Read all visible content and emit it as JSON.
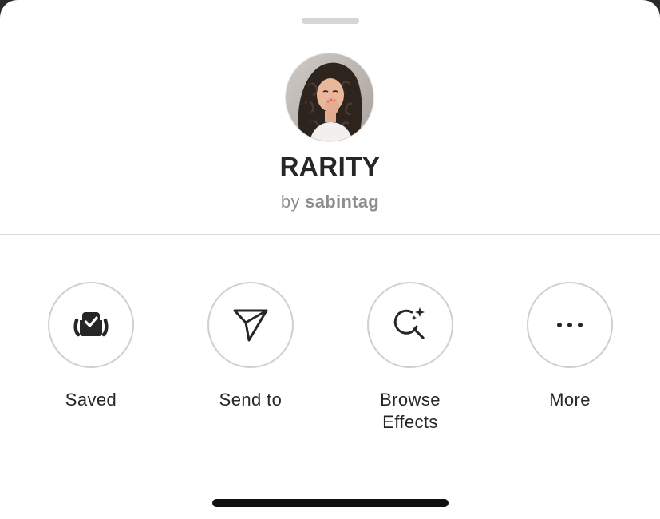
{
  "sheet": {
    "effect_name": "RARITY",
    "by_prefix": "by",
    "creator": "sabintag",
    "avatar_icon": "creator-avatar"
  },
  "actions": [
    {
      "label": "Saved",
      "icon": "saved-check-icon"
    },
    {
      "label": "Send to",
      "icon": "paper-plane-icon"
    },
    {
      "label": "Browse Effects",
      "icon": "search-sparkle-icon"
    },
    {
      "label": "More",
      "icon": "more-dots-icon"
    }
  ],
  "colors": {
    "text_primary": "#262626",
    "text_secondary": "#8e8e8e",
    "circle_border": "#cfcfcf",
    "divider": "#dbdbdb",
    "grabber": "#d6d6d6"
  }
}
